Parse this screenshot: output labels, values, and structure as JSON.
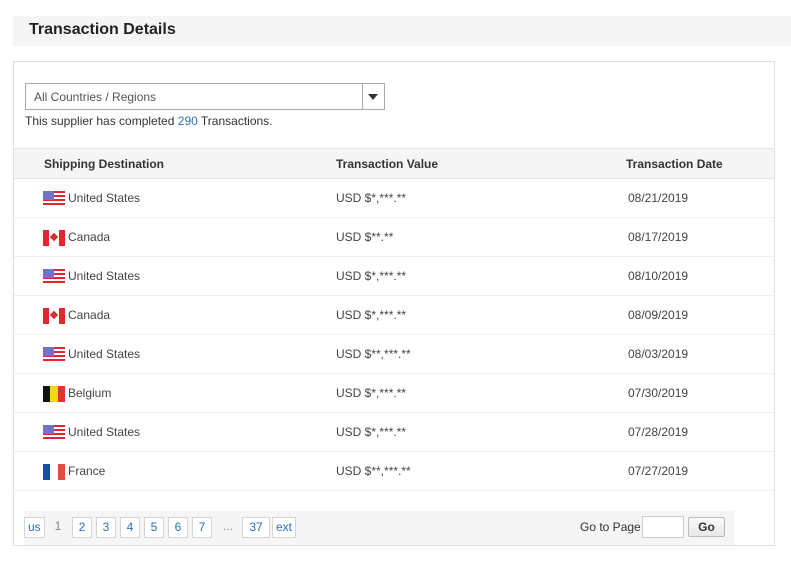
{
  "header": {
    "title": "Transaction Details"
  },
  "filter": {
    "selected": "All Countries / Regions"
  },
  "summary": {
    "prefix": "This supplier has completed",
    "count": "290",
    "suffix": "Transactions."
  },
  "table": {
    "columns": [
      "Shipping Destination",
      "Transaction Value",
      "Transaction Date"
    ],
    "rows": [
      {
        "flag": "us",
        "country": "United States",
        "value": "USD $*,***.**",
        "date": "08/21/2019"
      },
      {
        "flag": "ca",
        "country": "Canada",
        "value": "USD $**.**",
        "date": "08/17/2019"
      },
      {
        "flag": "us",
        "country": "United States",
        "value": "USD $*,***.**",
        "date": "08/10/2019"
      },
      {
        "flag": "ca",
        "country": "Canada",
        "value": "USD $*,***.**",
        "date": "08/09/2019"
      },
      {
        "flag": "us",
        "country": "United States",
        "value": "USD $**,***.**",
        "date": "08/03/2019"
      },
      {
        "flag": "be",
        "country": "Belgium",
        "value": "USD $*,***.**",
        "date": "07/30/2019"
      },
      {
        "flag": "us",
        "country": "United States",
        "value": "USD $*,***.**",
        "date": "07/28/2019"
      },
      {
        "flag": "fr",
        "country": "France",
        "value": "USD $**,***.**",
        "date": "07/27/2019"
      }
    ]
  },
  "pagination": {
    "prev_label": "us",
    "current": "1",
    "pages": [
      "2",
      "3",
      "4",
      "5",
      "6",
      "7"
    ],
    "ellipsis": "...",
    "last": "37",
    "next_label": "ext",
    "goto_label": "Go to Page",
    "goto_value": "",
    "go_button": "Go"
  }
}
